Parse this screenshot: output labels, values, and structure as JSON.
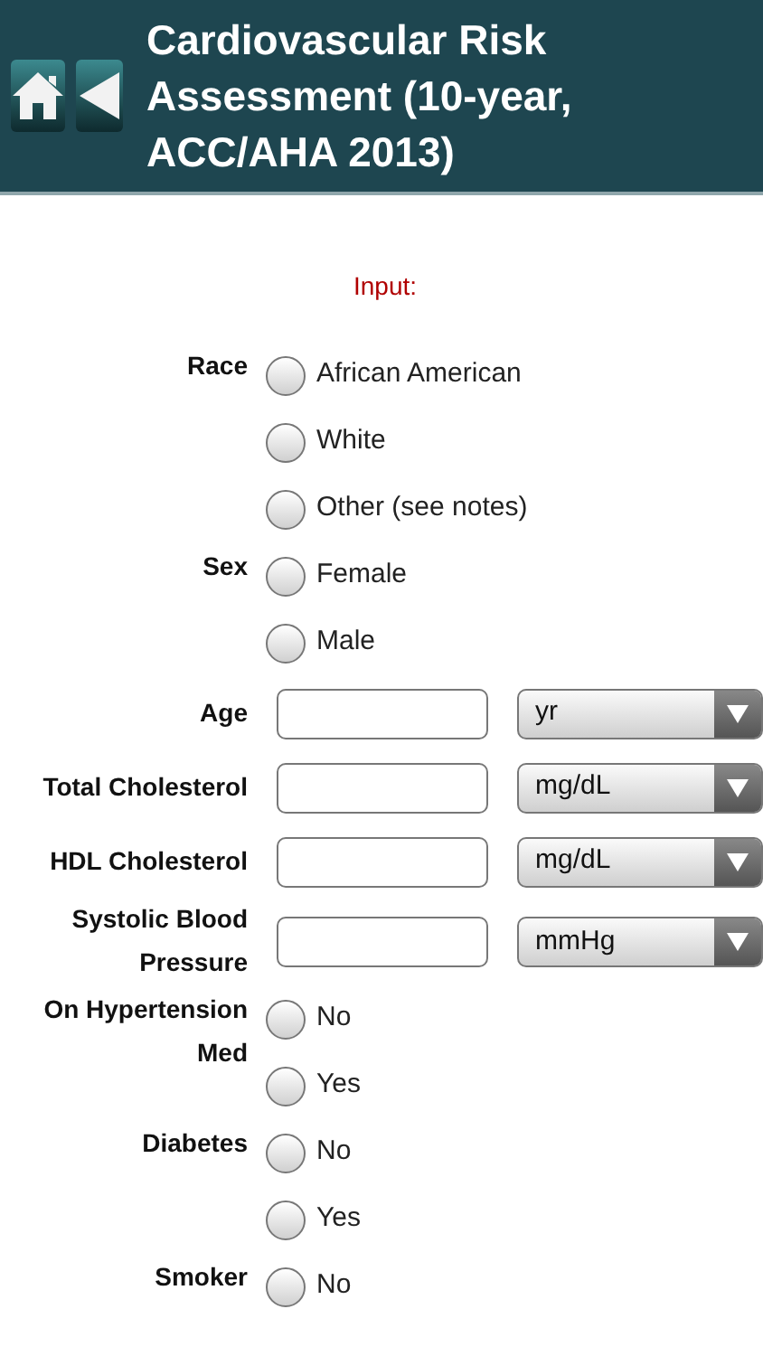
{
  "header": {
    "title": "Cardiovascular Risk Assessment (10-year, ACC/AHA 2013)"
  },
  "section_title": "Input:",
  "fields": [
    {
      "kind": "radio",
      "label": "Race",
      "options": [
        {
          "label": "African American",
          "selected": false
        },
        {
          "label": "White",
          "selected": false
        },
        {
          "label": "Other (see notes)",
          "selected": false
        }
      ]
    },
    {
      "kind": "radio",
      "label": "Sex",
      "options": [
        {
          "label": "Female",
          "selected": false
        },
        {
          "label": "Male",
          "selected": false
        }
      ]
    },
    {
      "kind": "number",
      "label": "Age",
      "unit": "yr"
    },
    {
      "kind": "number",
      "label": "Total Cholesterol",
      "unit": "mg/dL"
    },
    {
      "kind": "number",
      "label": "HDL Cholesterol",
      "unit": "mg/dL"
    },
    {
      "kind": "number",
      "label": "Systolic Blood Pressure",
      "unit": "mmHg"
    },
    {
      "kind": "radio",
      "label": "On Hypertension Med",
      "options": [
        {
          "label": "No",
          "selected": false
        },
        {
          "label": "Yes",
          "selected": false
        }
      ]
    },
    {
      "kind": "radio",
      "label": "Diabetes",
      "options": [
        {
          "label": "No",
          "selected": false
        },
        {
          "label": "Yes",
          "selected": false
        }
      ]
    },
    {
      "kind": "radio",
      "label": "Smoker",
      "options": [
        {
          "label": "No",
          "selected": false
        }
      ]
    }
  ]
}
